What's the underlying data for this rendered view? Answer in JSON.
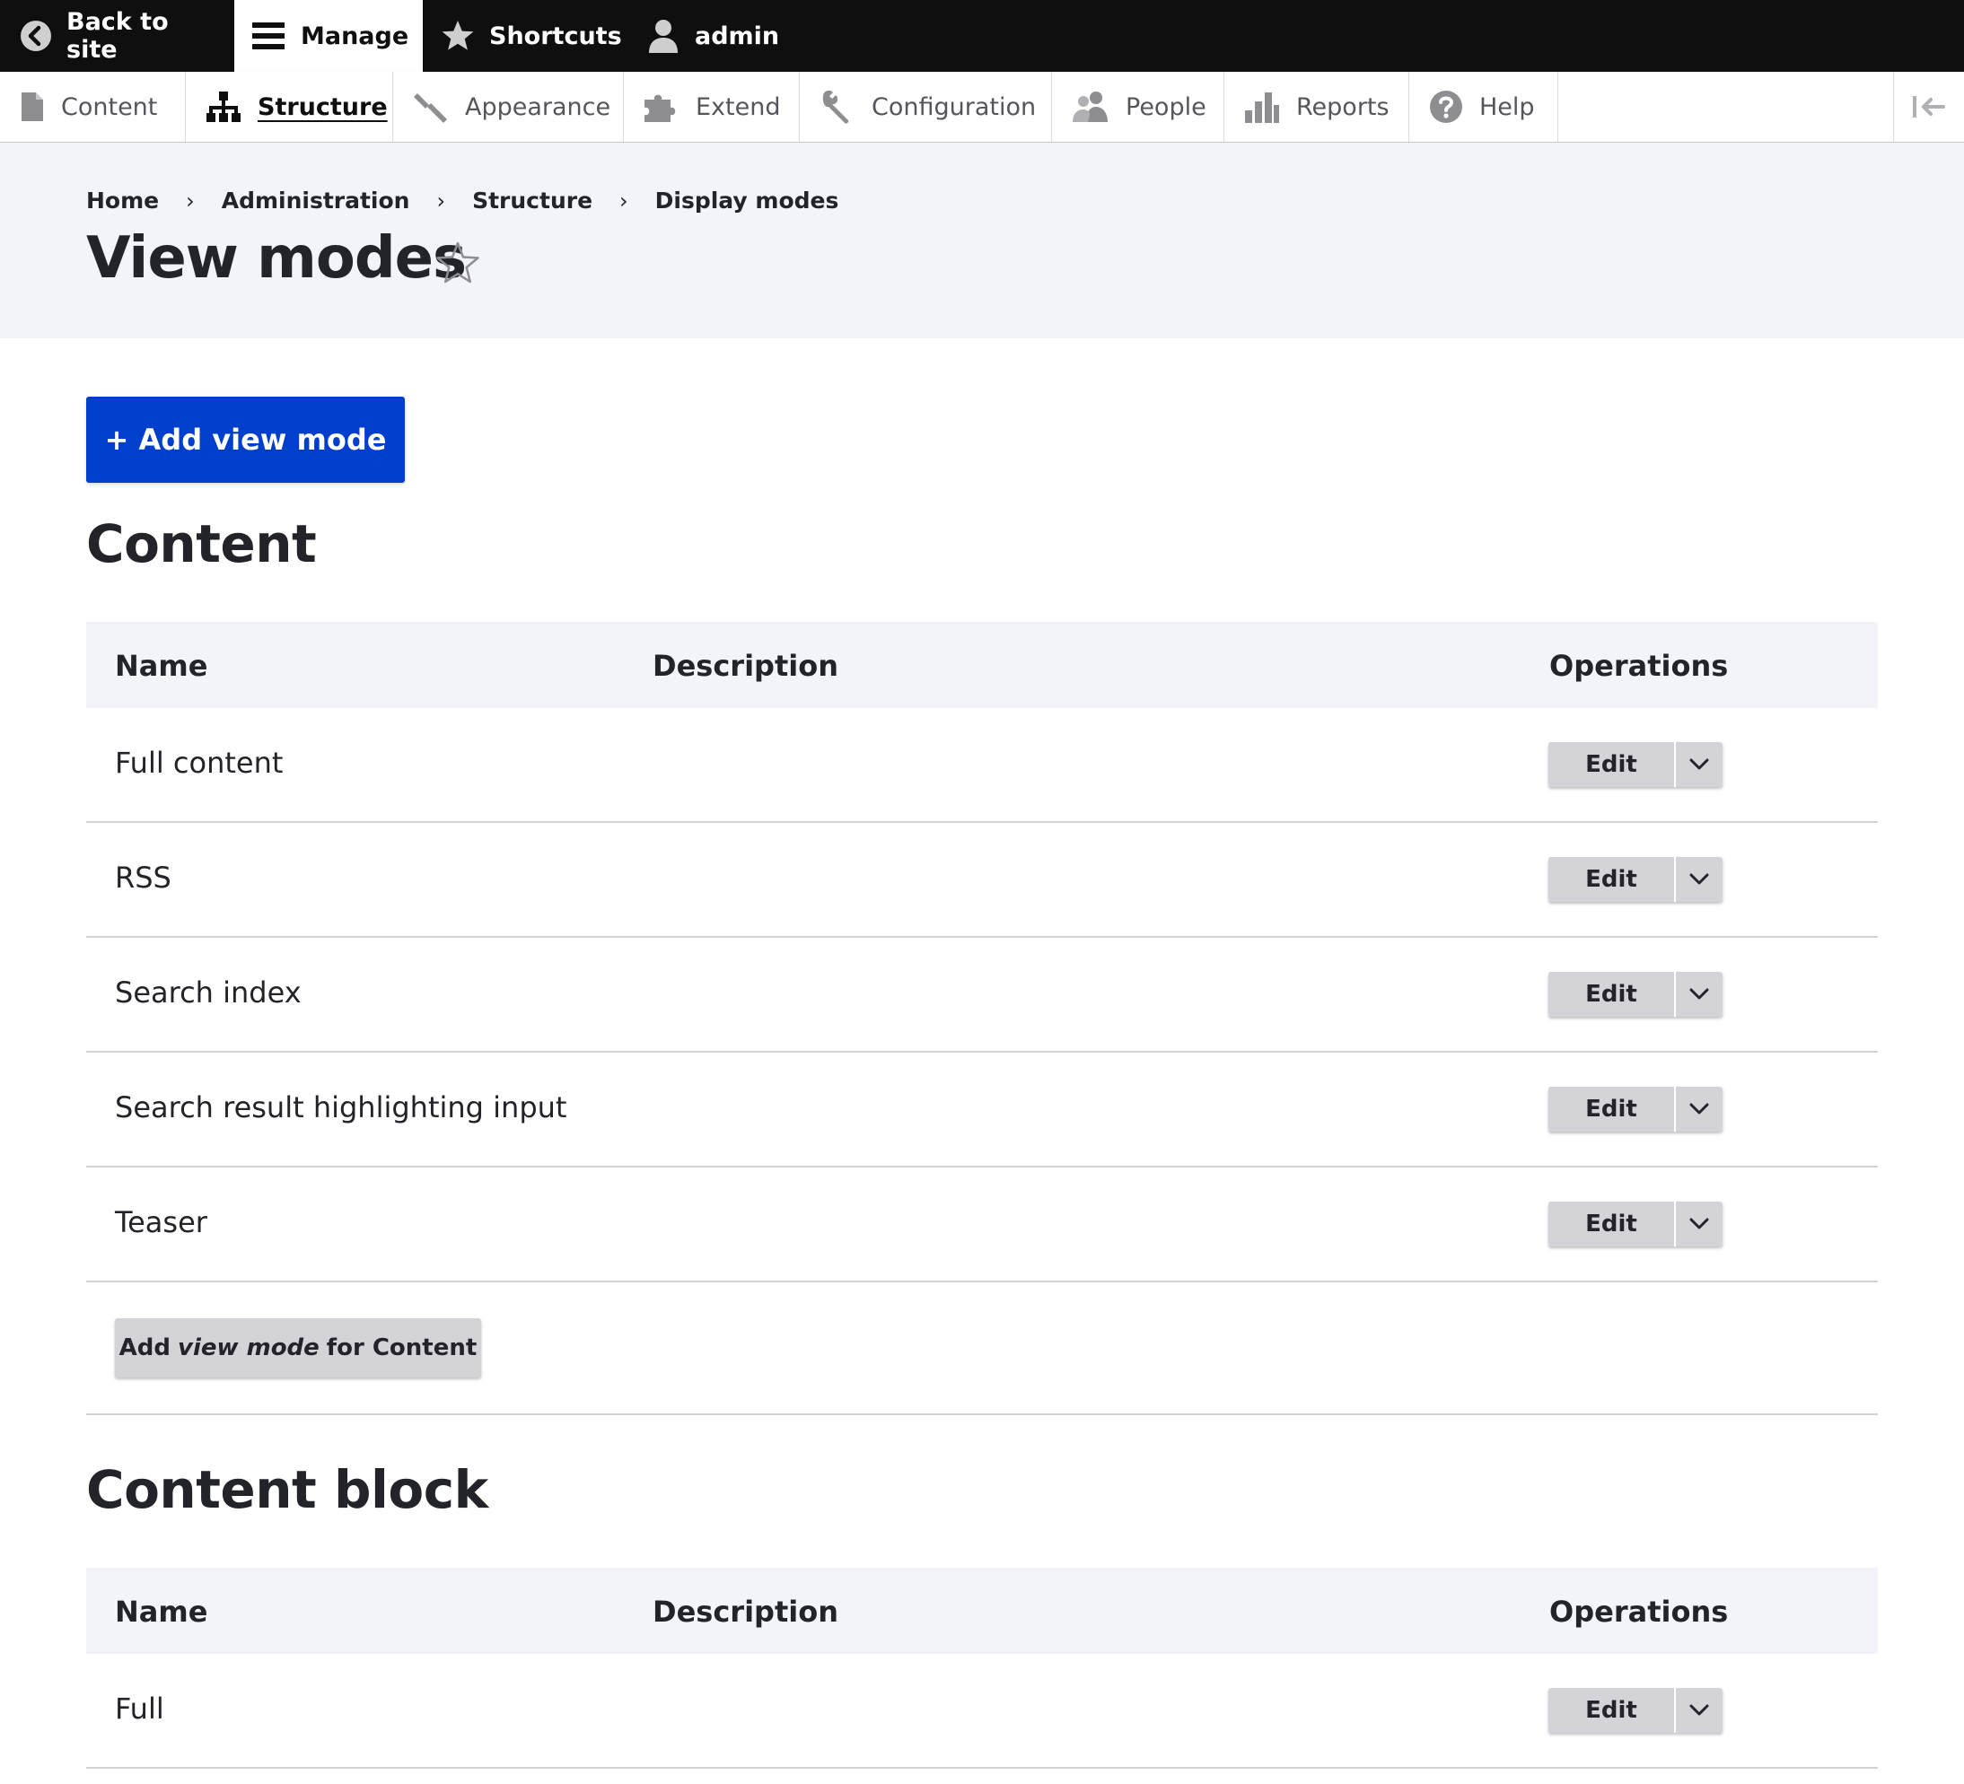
{
  "toolbar": {
    "back_label": "Back to site",
    "manage_label": "Manage",
    "shortcuts_label": "Shortcuts",
    "user_label": "admin"
  },
  "tray": {
    "items": [
      {
        "label": "Content",
        "icon": "file-icon"
      },
      {
        "label": "Structure",
        "icon": "sitemap-icon"
      },
      {
        "label": "Appearance",
        "icon": "paintbrush-icon"
      },
      {
        "label": "Extend",
        "icon": "puzzle-icon"
      },
      {
        "label": "Configuration",
        "icon": "wrench-icon"
      },
      {
        "label": "People",
        "icon": "people-icon"
      },
      {
        "label": "Reports",
        "icon": "bar-chart-icon"
      },
      {
        "label": "Help",
        "icon": "question-icon"
      }
    ],
    "active": "Structure"
  },
  "breadcrumb": [
    "Home",
    "Administration",
    "Structure",
    "Display modes"
  ],
  "page_title": "View modes",
  "add_button_label": "+ Add view mode",
  "sections": [
    {
      "title": "Content",
      "columns": [
        "Name",
        "Description",
        "Operations"
      ],
      "rows": [
        {
          "name": "Full content",
          "operation": "Edit"
        },
        {
          "name": "RSS",
          "operation": "Edit"
        },
        {
          "name": "Search index",
          "operation": "Edit"
        },
        {
          "name": "Search result highlighting input",
          "operation": "Edit"
        },
        {
          "name": "Teaser",
          "operation": "Edit"
        }
      ],
      "add_button": {
        "prefix": "Add",
        "emphasis": "view mode",
        "suffix": "for Content"
      }
    },
    {
      "title": "Content block",
      "columns": [
        "Name",
        "Description",
        "Operations"
      ],
      "rows": [
        {
          "name": "Full",
          "operation": "Edit"
        }
      ]
    }
  ],
  "colors": {
    "primary": "#003ecc",
    "toolbar_bg": "#0f0f0f",
    "header_bg": "#f3f4f9",
    "button_grey": "#d4d4d8"
  }
}
